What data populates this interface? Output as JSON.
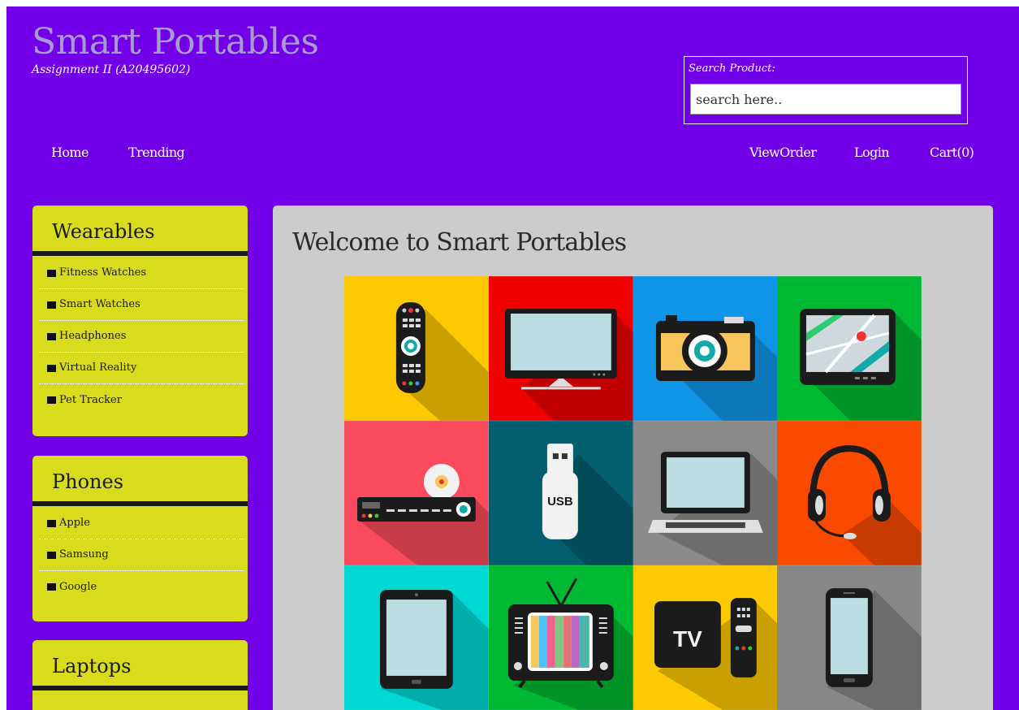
{
  "header": {
    "title": "Smart Portables",
    "subtitle": "Assignment II (A20495602)",
    "search_label": "Search Product:",
    "search_placeholder": "search here.."
  },
  "nav": {
    "left": [
      "Home",
      "Trending"
    ],
    "right": [
      "ViewOrder",
      "Login",
      "Cart(0)"
    ]
  },
  "sidebar": [
    {
      "title": "Wearables",
      "items": [
        "Fitness Watches",
        "Smart Watches",
        "Headphones",
        "Virtual Reality",
        "Pet Tracker"
      ]
    },
    {
      "title": "Phones",
      "items": [
        "Apple",
        "Samsung",
        "Google"
      ]
    },
    {
      "title": "Laptops",
      "items": []
    }
  ],
  "main": {
    "heading": "Welcome to Smart Portables",
    "tiles": [
      {
        "icon": "remote-control-icon",
        "bg": "#fdc900"
      },
      {
        "icon": "monitor-icon",
        "bg": "#f10000"
      },
      {
        "icon": "camera-icon",
        "bg": "#0f95e8"
      },
      {
        "icon": "gps-tablet-icon",
        "bg": "#00b933"
      },
      {
        "icon": "dvd-player-icon",
        "bg": "#fa4b5c"
      },
      {
        "icon": "usb-drive-icon",
        "bg": "#035e70"
      },
      {
        "icon": "laptop-icon",
        "bg": "#8a8a8a"
      },
      {
        "icon": "headphones-icon",
        "bg": "#fa4a00"
      },
      {
        "icon": "tablet-icon",
        "bg": "#00d9d4"
      },
      {
        "icon": "retro-tv-icon",
        "bg": "#00b933"
      },
      {
        "icon": "tv-box-icon",
        "bg": "#fdc900"
      },
      {
        "icon": "smartphone-icon",
        "bg": "#878787"
      }
    ]
  },
  "colors": {
    "background": "#7100e8",
    "sidebar": "#d8dc1c",
    "title": "#a89bcf",
    "main_panel": "#cccccc"
  }
}
